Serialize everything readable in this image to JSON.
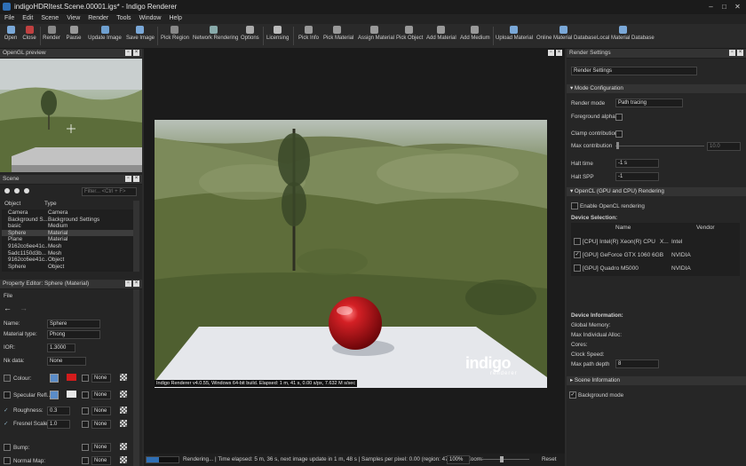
{
  "window": {
    "title": "indigoHDRItest.Scene.00001.igs* - Indigo Renderer"
  },
  "menu": [
    "File",
    "Edit",
    "Scene",
    "View",
    "Render",
    "Tools",
    "Window",
    "Help"
  ],
  "toolbar": {
    "buttons": [
      "Open",
      "Close",
      "Render",
      "Pause",
      "Update Image",
      "Save Image",
      "Pick Region",
      "Network Rendering",
      "Options",
      "Licensing",
      "Pick Info",
      "Pick Material",
      "Assign Material",
      "Pick Object",
      "Add Material",
      "Add Medium",
      "Upload Material",
      "Online Material Database",
      "Local Material Database"
    ]
  },
  "opengl_preview": {
    "title": "OpenGL preview"
  },
  "scene": {
    "title": "Scene",
    "filter_placeholder": "Filter... <Ctrl + F>",
    "col_object": "Object",
    "col_type": "Type",
    "rows": [
      {
        "object": "Camera",
        "type": "Camera"
      },
      {
        "object": "Background S...",
        "type": "Background Settings"
      },
      {
        "object": "basic",
        "type": "Medium"
      },
      {
        "object": "Sphere",
        "type": "Material"
      },
      {
        "object": "Plane",
        "type": "Material"
      },
      {
        "object": "9162cc6ee41c...",
        "type": "Mesh"
      },
      {
        "object": "5adc1150d3b...",
        "type": "Mesh"
      },
      {
        "object": "9162cc6ee41c...",
        "type": "Object"
      },
      {
        "object": "Sphere",
        "type": "Object"
      }
    ]
  },
  "property_editor": {
    "title": "Property Editor: Sphere (Material)",
    "file_label": "File",
    "name_label": "Name:",
    "name_value": "Sphere",
    "material_type_label": "Material type:",
    "material_type_value": "Phong",
    "ior_label": "IOR:",
    "ior_value": "1.3000",
    "nk_label": "Nk data:",
    "nk_value": "None",
    "colour_label": "Colour:",
    "colour_tex": "None",
    "specular_label": "Specular Refl...",
    "specular_tex": "None",
    "roughness_label": "Roughness:",
    "roughness_value": "0.3",
    "roughness_tex": "None",
    "fresnel_label": "Fresnel Scale:",
    "fresnel_value": "1.0",
    "fresnel_tex": "None",
    "bump_label": "Bump:",
    "bump_tex": "None",
    "normal_label": "Normal Map:",
    "normal_tex": "None"
  },
  "render_view": {
    "info_bar": "Indigo Renderer v4.0.55, Windows 64-bit build. Elapsed: 1 m, 41 s, 0.00 s/px, 7.632 M s/sec",
    "logo": "indigo",
    "logo_sub": "renderer"
  },
  "statusbar": {
    "text": "Rendering... | Time elapsed: 5 m, 36 s, next image update in 1 m, 48 s | Samples per pixel: 0.00 (region: 4786.08), Zoom:",
    "zoom": "100%",
    "reset": "Reset"
  },
  "render_settings": {
    "title": "Render Settings",
    "dropdown": "Render Settings",
    "mode_section": "Mode Configuration",
    "render_mode_label": "Render mode",
    "render_mode_value": "Path tracing",
    "fg_alpha_label": "Foreground alpha",
    "clamp_label": "Clamp contributions",
    "max_contrib_label": "Max contribution",
    "max_contrib_value": "10.0",
    "halt_time_label": "Halt time",
    "halt_time_value": "-1 s",
    "halt_spp_label": "Halt SPP",
    "halt_spp_value": "-1",
    "opencl_section": "OpenCL (GPU and CPU) Rendering",
    "enable_opencl": "Enable OpenCL rendering",
    "device_selection": "Device Selection:",
    "col_name": "Name",
    "col_vendor": "Vendor",
    "devices": [
      {
        "name": "[CPU] Intel(R) Xeon(R) CPU",
        "extra": "X...",
        "vendor": "Intel",
        "checked": false
      },
      {
        "name": "[GPU] GeForce GTX 1060 6GB",
        "extra": "",
        "vendor": "NVIDIA",
        "checked": true
      },
      {
        "name": "[GPU] Quadro M5000",
        "extra": "",
        "vendor": "NVIDIA",
        "checked": false
      }
    ],
    "device_info": "Device Information:",
    "global_memory": "Global Memory:",
    "max_alloc": "Max Individual Alloc:",
    "cores": "Cores:",
    "clock": "Clock Speed:",
    "max_path_label": "Max path depth",
    "max_path_value": "8",
    "scene_info_section": "Scene Information",
    "bg_mode": "Background mode"
  },
  "colors": {
    "accent": "#2f6fb5",
    "sphere": "#c8161b",
    "colour_swatch": "#d31c1c"
  }
}
